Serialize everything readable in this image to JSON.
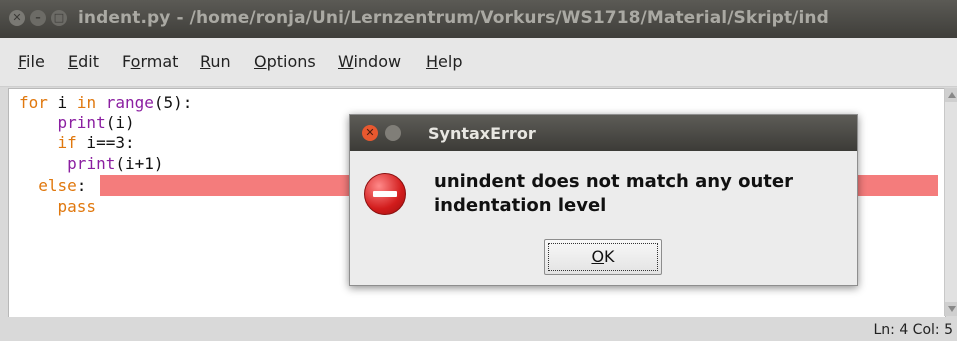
{
  "window": {
    "title": "indent.py - /home/ronja/Uni/Lernzentrum/Vorkurs/WS1718/Material/Skript/ind",
    "buttons": {
      "close_icon": "close-icon",
      "minimize_icon": "minimize-icon",
      "maximize_icon": "maximize-icon"
    }
  },
  "menu": {
    "items": [
      {
        "mnemonic": "F",
        "rest": "ile"
      },
      {
        "mnemonic": "E",
        "rest": "dit"
      },
      {
        "pre": "F",
        "mnemonic": "o",
        "rest": "rmat"
      },
      {
        "mnemonic": "R",
        "rest": "un"
      },
      {
        "mnemonic": "O",
        "rest": "ptions"
      },
      {
        "mnemonic": "W",
        "rest": "indow"
      },
      {
        "mnemonic": "H",
        "rest": "elp"
      }
    ]
  },
  "editor": {
    "lines": [
      {
        "indent": "",
        "kw": "for",
        "text": " i ",
        "kw2": "in",
        "bi": " range",
        "tail": "(5):"
      },
      {
        "indent": "    ",
        "bi": "print",
        "tail": "(i)"
      },
      {
        "indent": "    ",
        "kw": "if",
        "tail": " i==3:"
      },
      {
        "indent": "     ",
        "bi": "print",
        "tail": "(i+1)"
      },
      {
        "indent": "  ",
        "kw": "else",
        "tail": ":"
      },
      {
        "indent": "    ",
        "kw": "pass"
      }
    ],
    "error_highlight_color": "#f47c7c",
    "keyword_color": "#e0780e",
    "builtin_color": "#8b1fa1"
  },
  "status": {
    "line_col": "Ln: 4  Col: 5"
  },
  "dialog": {
    "title": "SyntaxError",
    "message": "unindent does not match any outer indentation level",
    "icon": "error-icon",
    "ok_mnemonic": "O",
    "ok_rest": "K"
  }
}
